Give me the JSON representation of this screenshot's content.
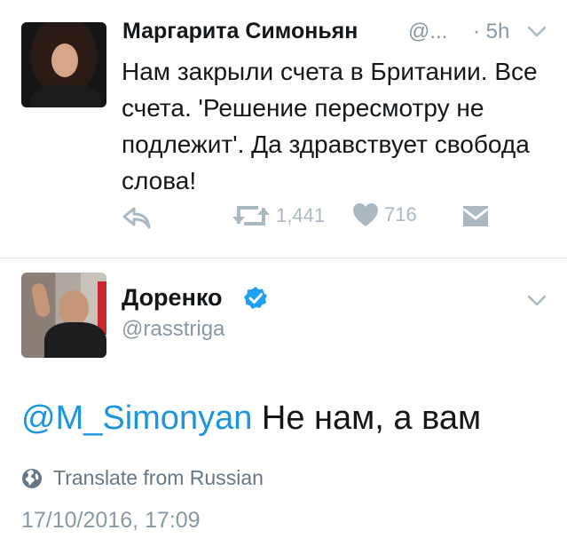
{
  "tweet1": {
    "author_name": "Маргарита Симоньян",
    "handle": "@...",
    "time": "· 5h",
    "text": "Нам закрыли счета в Британии. Все счета. 'Решение пересмотру не подлежит'. Да здравствует свобода слова!",
    "retweets": "1,441",
    "likes": "716"
  },
  "tweet2": {
    "author_name": "Доренко",
    "handle": "@rasstriga",
    "mention": "@M_Simonyan",
    "text": " Не нам, а вам",
    "translate_label": "Translate from Russian",
    "datetime": "17/10/2016, 17:09"
  },
  "icons": {
    "reply": "reply-icon",
    "retweet": "retweet-icon",
    "like": "heart-icon",
    "dm": "envelope-icon",
    "menu": "chevron-down-icon",
    "verified": "verified-badge-icon",
    "globe": "globe-icon"
  },
  "colors": {
    "text": "#14171a",
    "secondary": "#8899a6",
    "action": "#aab8c2",
    "link": "#1b95e0",
    "verified": "#1da1f2"
  }
}
